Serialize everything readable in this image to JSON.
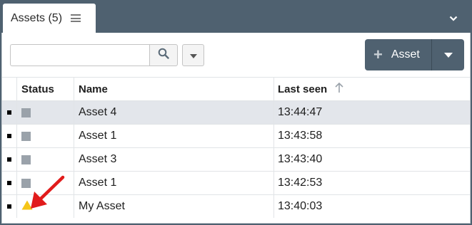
{
  "tab": {
    "label": "Assets (5)"
  },
  "search": {
    "value": "",
    "placeholder": ""
  },
  "add_button": {
    "label": "Asset"
  },
  "table": {
    "columns": [
      "Status",
      "Name",
      "Last seen"
    ],
    "sort_column": "Last seen",
    "rows": [
      {
        "status": "grey",
        "name": "Asset 4",
        "last_seen": "13:44:47",
        "selected": true
      },
      {
        "status": "grey",
        "name": "Asset 1",
        "last_seen": "13:43:58",
        "selected": false
      },
      {
        "status": "grey",
        "name": "Asset 3",
        "last_seen": "13:43:40",
        "selected": false
      },
      {
        "status": "grey",
        "name": "Asset 1",
        "last_seen": "13:42:53",
        "selected": false
      },
      {
        "status": "warning",
        "name": "My Asset",
        "last_seen": "13:40:03",
        "selected": false
      }
    ]
  },
  "colors": {
    "header_bar": "#4f6170",
    "status_grey": "#9aa2aa",
    "status_warning": "#f5c518",
    "selected_row": "#e3e6eb",
    "annotation_arrow": "#e11b1b"
  },
  "icons": {
    "tab_menu": "hamburger-icon",
    "tabbar": "chevron-down-icon",
    "search": "search-icon",
    "filter": "caret-down-icon",
    "add": "plus-icon",
    "add_menu": "caret-down-icon",
    "sort": "arrow-up-icon",
    "warning": "warning-triangle-icon",
    "annotation": "red-arrow-icon"
  }
}
